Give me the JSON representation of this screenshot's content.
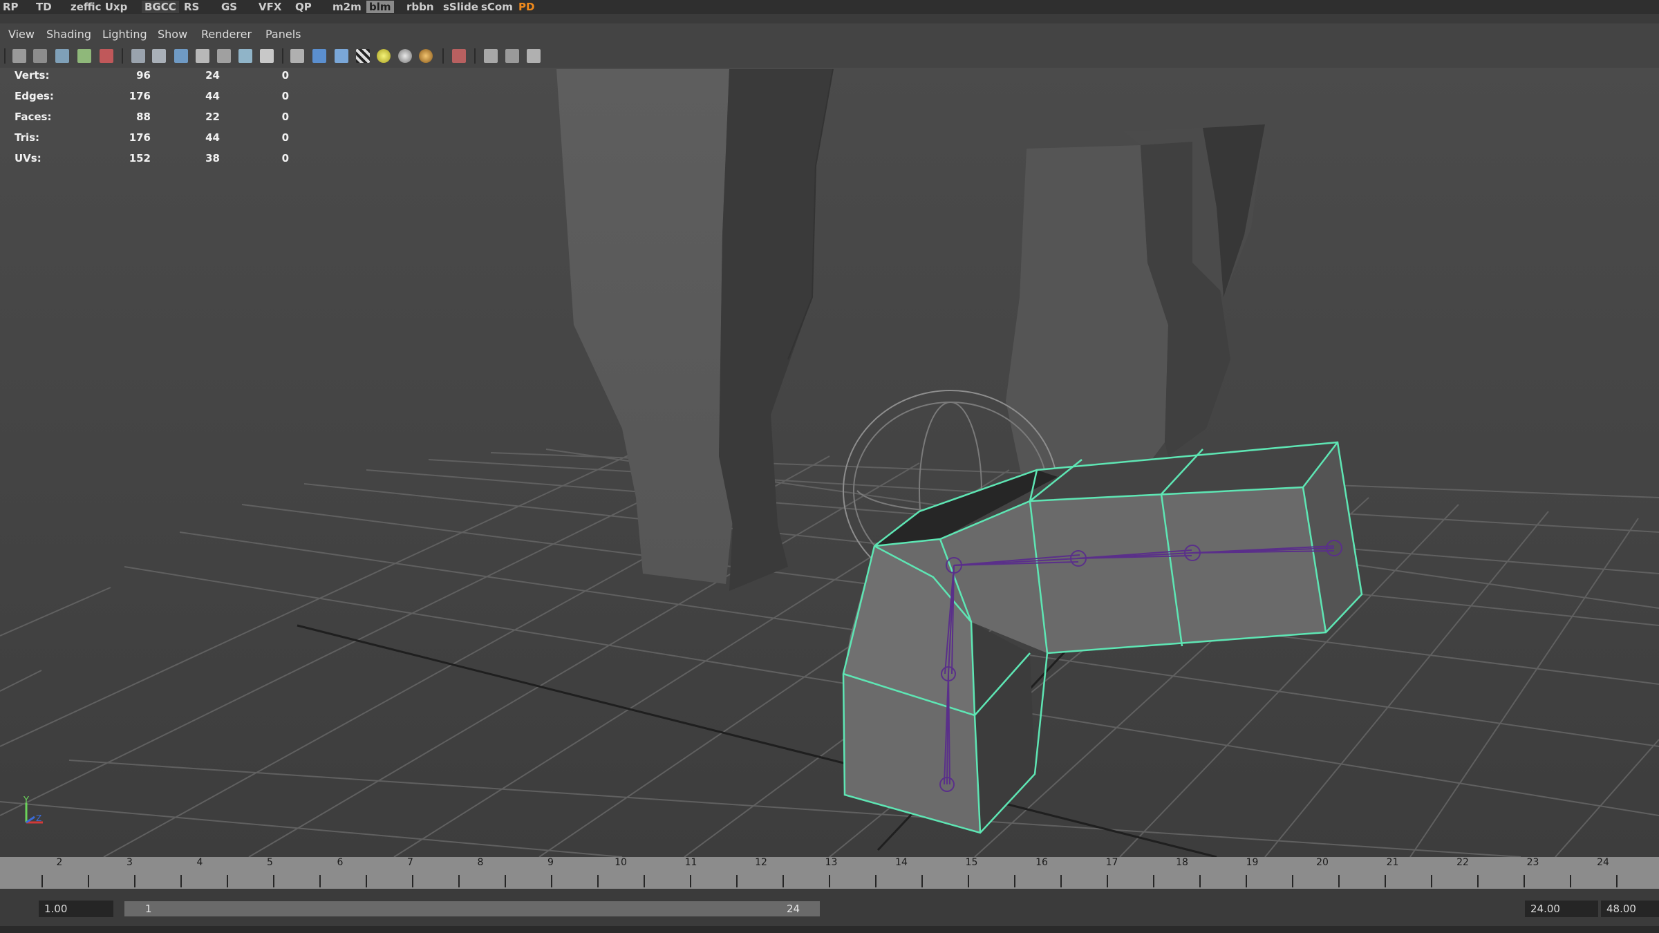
{
  "shelf": {
    "tabs": [
      "RP",
      "TD",
      "zeffic Uxp",
      "BGCC",
      "RS",
      "GS",
      "VFX",
      "QP",
      "m2m",
      "blm",
      "rbbn",
      "sSlide",
      "sCom",
      "PD"
    ],
    "active_tab": "blm",
    "accent_tab": "PD"
  },
  "panel_menu": [
    "View",
    "Shading",
    "Lighting",
    "Show",
    "Renderer",
    "Panels"
  ],
  "toolbar_icons": [
    "camera-select-icon",
    "camera-attributes-icon",
    "bookmarks-icon",
    "image-plane-icon",
    "2d-pan-zoom-icon",
    "grease-pencil-icon",
    "grid-icon",
    "film-gate-icon",
    "resolution-gate-icon",
    "gate-mask-icon",
    "field-chart-icon",
    "safe-action-icon",
    "safe-title-icon",
    "wireframe-icon",
    "smooth-shade-icon",
    "wireframe-on-shaded-icon",
    "textured-icon",
    "use-all-lights-icon",
    "shadows-icon",
    "ambient-occlusion-icon",
    "isolate-select-icon",
    "xray-icon",
    "xray-joints-icon",
    "xray-components-icon"
  ],
  "hud": {
    "rows": [
      {
        "label": "Verts:",
        "v1": "96",
        "v2": "24",
        "v3": "0"
      },
      {
        "label": "Edges:",
        "v1": "176",
        "v2": "44",
        "v3": "0"
      },
      {
        "label": "Faces:",
        "v1": "88",
        "v2": "22",
        "v3": "0"
      },
      {
        "label": "Tris:",
        "v1": "176",
        "v2": "44",
        "v3": "0"
      },
      {
        "label": "UVs:",
        "v1": "152",
        "v2": "38",
        "v3": "0"
      }
    ]
  },
  "axis_gizmo": {
    "y": "Y",
    "z": "Z"
  },
  "timeline": {
    "ticks": [
      "2",
      "3",
      "4",
      "5",
      "6",
      "7",
      "8",
      "9",
      "10",
      "11",
      "12",
      "13",
      "14",
      "15",
      "16",
      "17",
      "18",
      "19",
      "20",
      "21",
      "22",
      "23",
      "24"
    ]
  },
  "range": {
    "start_time": "1.00",
    "slider_start": "1",
    "slider_end": "24",
    "end_time": "24.00",
    "anim_end": "48.00"
  },
  "colors": {
    "selection_highlight": "#5ee6b4",
    "joint": "#5a2f8a",
    "accent_orange": "#f08a1c"
  }
}
